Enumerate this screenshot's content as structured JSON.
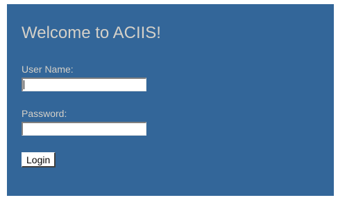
{
  "login_form": {
    "title": "Welcome to ACIIS!",
    "username_label": "User Name:",
    "username_value": "",
    "password_label": "Password:",
    "password_value": "",
    "login_button_label": "Login"
  },
  "colors": {
    "panel_background": "#336699",
    "label_text": "#d4d0c8"
  }
}
